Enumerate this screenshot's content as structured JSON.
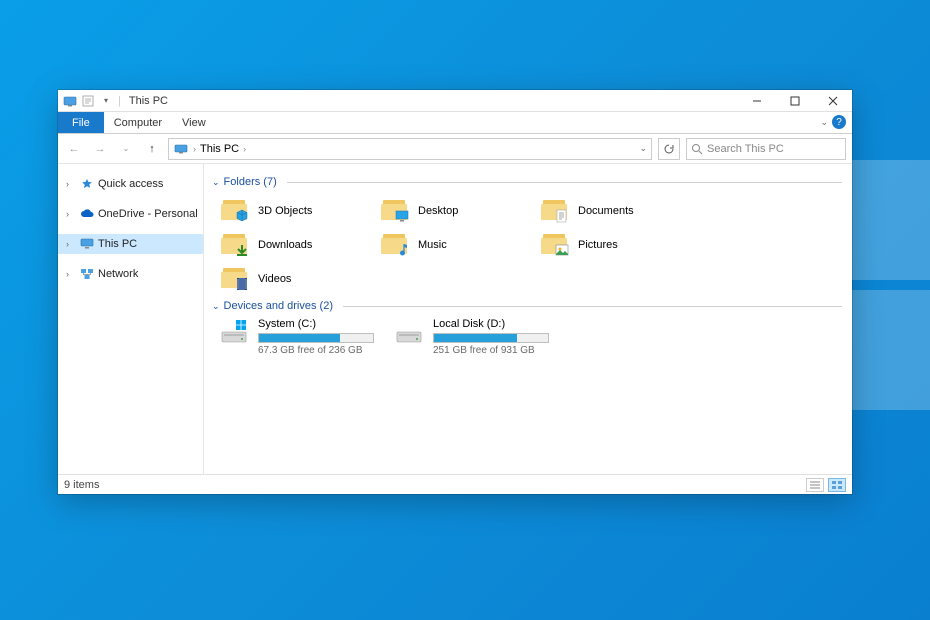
{
  "window": {
    "title": "This PC"
  },
  "ribbon": {
    "file_label": "File",
    "tabs": [
      "Computer",
      "View"
    ]
  },
  "address": {
    "breadcrumb": "This PC",
    "search_placeholder": "Search This PC"
  },
  "nav": {
    "items": [
      {
        "label": "Quick access",
        "icon": "star"
      },
      {
        "label": "OneDrive - Personal",
        "icon": "cloud"
      },
      {
        "label": "This PC",
        "icon": "pc",
        "selected": true
      },
      {
        "label": "Network",
        "icon": "network"
      }
    ]
  },
  "groups": {
    "folders_header": "Folders (7)",
    "drives_header": "Devices and drives (2)"
  },
  "folders": [
    {
      "label": "3D Objects",
      "overlay": "cube"
    },
    {
      "label": "Desktop",
      "overlay": "desktop"
    },
    {
      "label": "Documents",
      "overlay": "doc"
    },
    {
      "label": "Downloads",
      "overlay": "arrow"
    },
    {
      "label": "Music",
      "overlay": "note"
    },
    {
      "label": "Pictures",
      "overlay": "photo"
    },
    {
      "label": "Videos",
      "overlay": "film"
    }
  ],
  "drives": [
    {
      "label": "System (C:)",
      "subtext": "67.3 GB free of 236 GB",
      "fill_pct": 71,
      "fill_color": "#26a0da",
      "os": true
    },
    {
      "label": "Local Disk (D:)",
      "subtext": "251 GB free of 931 GB",
      "fill_pct": 73,
      "fill_color": "#26a0da",
      "os": false
    }
  ],
  "status": {
    "item_count": "9 items"
  }
}
